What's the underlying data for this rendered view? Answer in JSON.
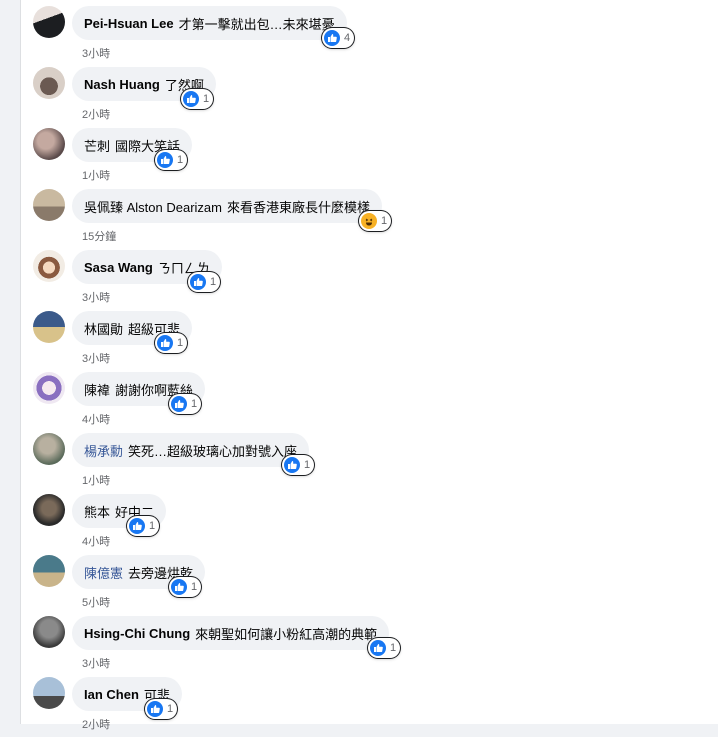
{
  "comments": [
    {
      "author": "Pei-Hsuan Lee",
      "text": "才第一擊就出包…未來堪憂",
      "time": "3小時",
      "reaction": "like",
      "count": "4",
      "blue": false,
      "avatar": [
        "#1c1e21",
        "#e8e0dc"
      ]
    },
    {
      "author": "Nash Huang",
      "text": "了然啊",
      "time": "2小時",
      "reaction": "like",
      "count": "1",
      "blue": false,
      "avatar": [
        "#6b5a52",
        "#d9cfc7"
      ]
    },
    {
      "author": "芒刺",
      "text": "國際大笑話",
      "time": "1小時",
      "reaction": "like",
      "count": "1",
      "blue": false,
      "avatar": [
        "#5a4a4a",
        "#c4a9a0"
      ]
    },
    {
      "author": "吳佩臻 Alston Dearizam",
      "text": "來看香港東廠長什麼模樣",
      "time": "15分鐘",
      "reaction": "haha",
      "count": "1",
      "blue": false,
      "avatar": [
        "#8a7a6a",
        "#c9b9a0"
      ]
    },
    {
      "author": "Sasa Wang",
      "text": "ㄋㄇㄥㄌ",
      "time": "3小時",
      "reaction": "like",
      "count": "1",
      "blue": false,
      "avatar": [
        "#f2ece4",
        "#8a5a40"
      ]
    },
    {
      "author": "林國勛",
      "text": "超級可悲",
      "time": "3小時",
      "reaction": "like",
      "count": "1",
      "blue": false,
      "avatar": [
        "#3b5a8a",
        "#d8c28a"
      ]
    },
    {
      "author": "陳褘",
      "text": "謝謝你啊藍絲",
      "time": "4小時",
      "reaction": "like",
      "count": "1",
      "blue": false,
      "avatar": [
        "#efe8f2",
        "#8a6fc0"
      ]
    },
    {
      "author": "楊承勳",
      "text": "笑死…超級玻璃心加對號入座",
      "time": "1小時",
      "reaction": "like",
      "count": "1",
      "blue": true,
      "avatar": [
        "#5a6a5a",
        "#b8b0a0"
      ]
    },
    {
      "author": "熊本",
      "text": "好中二",
      "time": "4小時",
      "reaction": "like",
      "count": "1",
      "blue": false,
      "avatar": [
        "#2a2a2a",
        "#7a6a5a"
      ]
    },
    {
      "author": "陳億憲",
      "text": "去旁邊烘乾",
      "time": "5小時",
      "reaction": "like",
      "count": "1",
      "blue": true,
      "avatar": [
        "#4a7a8a",
        "#c9b48a"
      ]
    },
    {
      "author": "Hsing-Chi Chung",
      "text": "來朝聖如何讓小粉紅高潮的典範",
      "time": "3小時",
      "reaction": "like",
      "count": "1",
      "blue": false,
      "avatar": [
        "#3a3a3a",
        "#8a8a8a"
      ]
    },
    {
      "author": "Ian Chen",
      "text": "可悲",
      "time": "2小時",
      "reaction": "like",
      "count": "1",
      "blue": false,
      "avatar": [
        "#a8c0d8",
        "#4a4a4a"
      ]
    }
  ],
  "colors": {
    "like": "#1877f2",
    "haha": "#f7b125",
    "link_author": "#385898"
  }
}
